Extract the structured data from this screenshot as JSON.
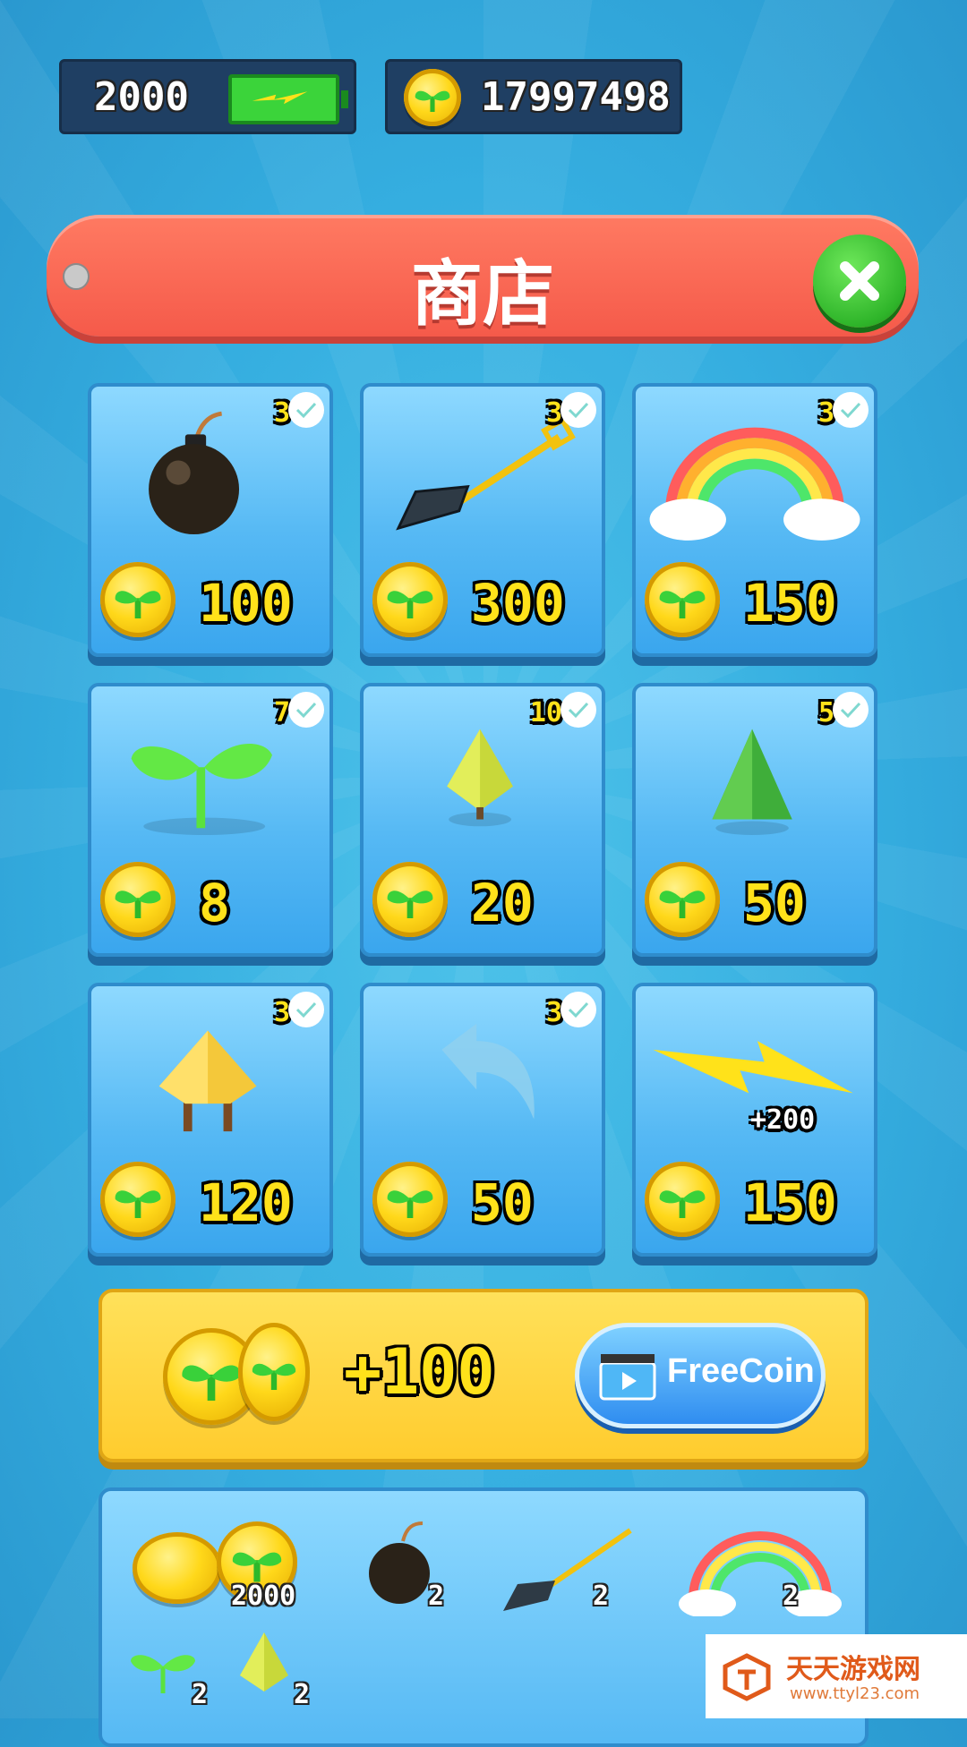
{
  "hud": {
    "energy": "2000",
    "coins": "17997498"
  },
  "title": "商店",
  "items": [
    {
      "name": "bomb",
      "count": "3",
      "price": "100"
    },
    {
      "name": "shovel",
      "count": "3",
      "price": "300"
    },
    {
      "name": "rainbow",
      "count": "3",
      "price": "150"
    },
    {
      "name": "sprout",
      "count": "7",
      "price": "8"
    },
    {
      "name": "small-tree",
      "count": "10",
      "price": "20"
    },
    {
      "name": "pine-tree",
      "count": "5",
      "price": "50"
    },
    {
      "name": "golden-tree",
      "count": "3",
      "price": "120"
    },
    {
      "name": "undo",
      "count": "3",
      "price": "50"
    },
    {
      "name": "energy",
      "bonus": "+200",
      "price": "150"
    }
  ],
  "free_coin": {
    "amount": "+100",
    "button_label": "FreeCoin"
  },
  "bundle": {
    "coins": "2000",
    "bomb": "2",
    "shovel": "2",
    "rainbow": "2",
    "sprout": "2",
    "tree": "2"
  },
  "watermark": {
    "title": "天天游戏网",
    "url": "www.ttyl23.com"
  },
  "colors": {
    "background": "#35aee0",
    "banner": "#f55a4a",
    "card": "#56b9f4",
    "coin": "#ffd81a",
    "price_text": "#ffe21a"
  }
}
